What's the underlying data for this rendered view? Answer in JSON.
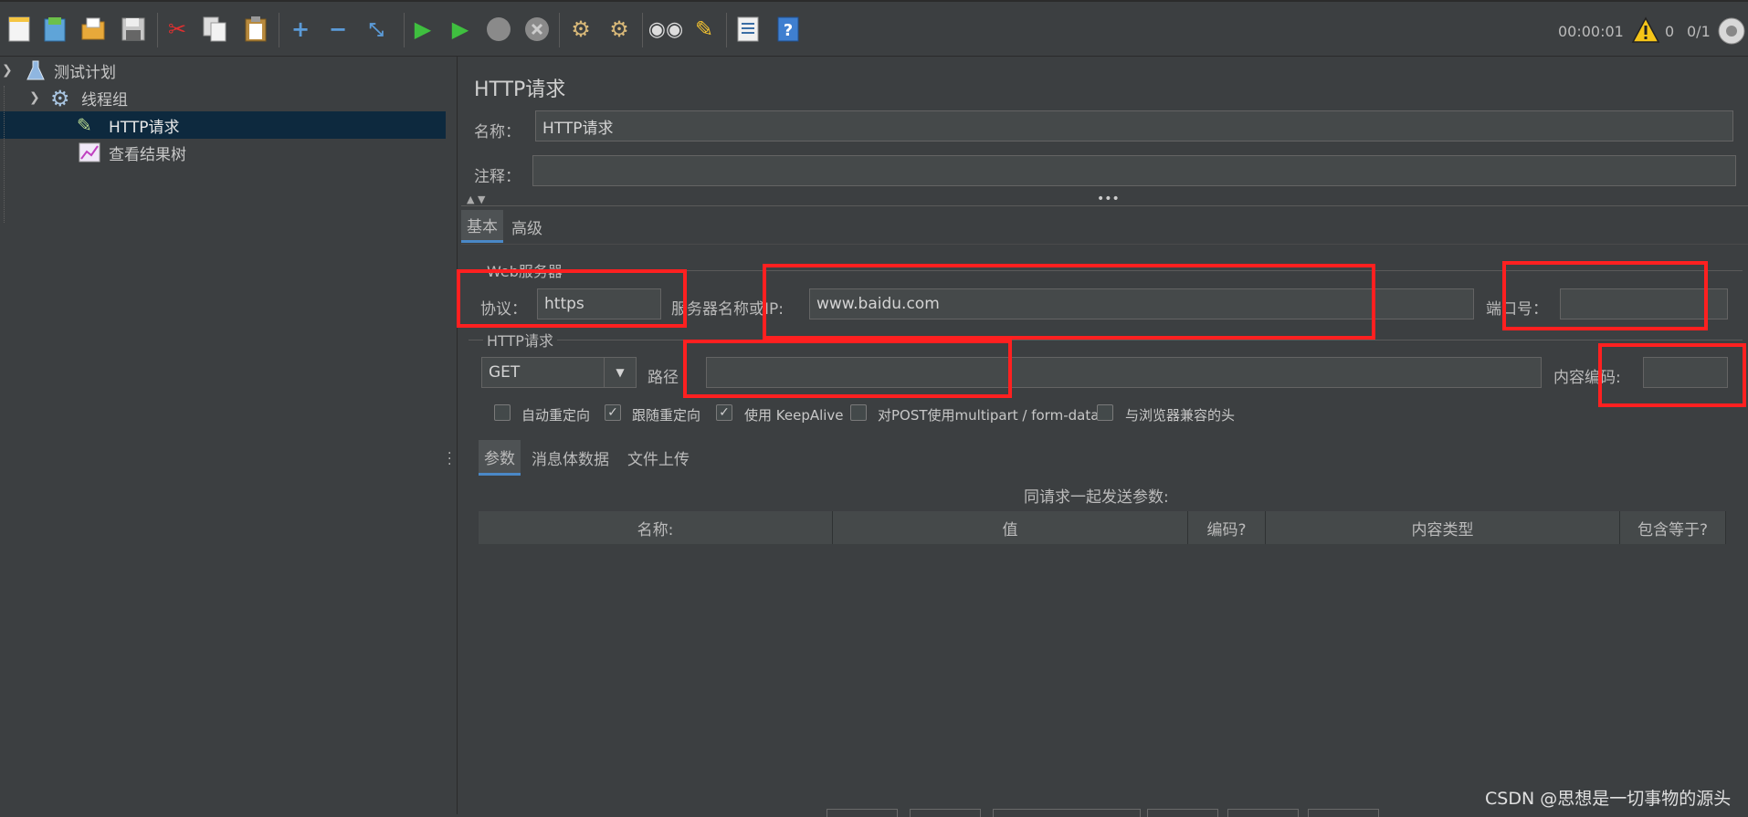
{
  "toolbar": {
    "icons": [
      "new-icon",
      "templates-icon",
      "open-icon",
      "save-icon",
      "cut-icon",
      "copy-icon",
      "paste-icon",
      "expand-icon",
      "collapse-icon",
      "toggle-icon",
      "start-icon",
      "start-no-pause-icon",
      "stop-icon",
      "shutdown-icon",
      "clear-icon",
      "clear-all-icon",
      "search-icon",
      "reset-search-icon",
      "function-helper-icon",
      "help-icon"
    ],
    "timer": "00:00:01",
    "warning_count": "0",
    "threads": "0/1"
  },
  "tree": {
    "items": [
      {
        "label": "测试计划"
      },
      {
        "label": "线程组"
      },
      {
        "label": "HTTP请求"
      },
      {
        "label": "查看结果树"
      }
    ]
  },
  "panel": {
    "title": "HTTP请求",
    "name_label": "名称：",
    "name_value": "HTTP请求",
    "comment_label": "注释：",
    "comment_value": "",
    "tabs": [
      "基本",
      "高级"
    ],
    "web_server_legend": "Web服务器",
    "protocol_label": "协议：",
    "protocol_value": "https",
    "server_label": "服务器名称或IP:",
    "server_value": "www.baidu.com",
    "port_label": "端口号：",
    "port_value": "",
    "http_request_legend": "HTTP请求",
    "method_value": "GET",
    "path_label": "路径",
    "path_value": "",
    "encoding_label": "内容编码:",
    "encoding_value": "",
    "checkboxes": [
      {
        "label": "自动重定向",
        "checked": false
      },
      {
        "label": "跟随重定向",
        "checked": true
      },
      {
        "label": "使用 KeepAlive",
        "checked": true
      },
      {
        "label": "对POST使用multipart / form-data",
        "checked": false
      },
      {
        "label": "与浏览器兼容的头",
        "checked": false
      }
    ],
    "subtabs": [
      "参数",
      "消息体数据",
      "文件上传"
    ],
    "params_caption": "同请求一起发送参数:",
    "columns": [
      "名称:",
      "值",
      "编码?",
      "内容类型",
      "包含等于?"
    ]
  },
  "watermark": "CSDN @思想是一切事物的源头",
  "colors": {
    "annotation": "#ff2020",
    "selection": "#0d293e",
    "accent": "#4a88c7"
  }
}
